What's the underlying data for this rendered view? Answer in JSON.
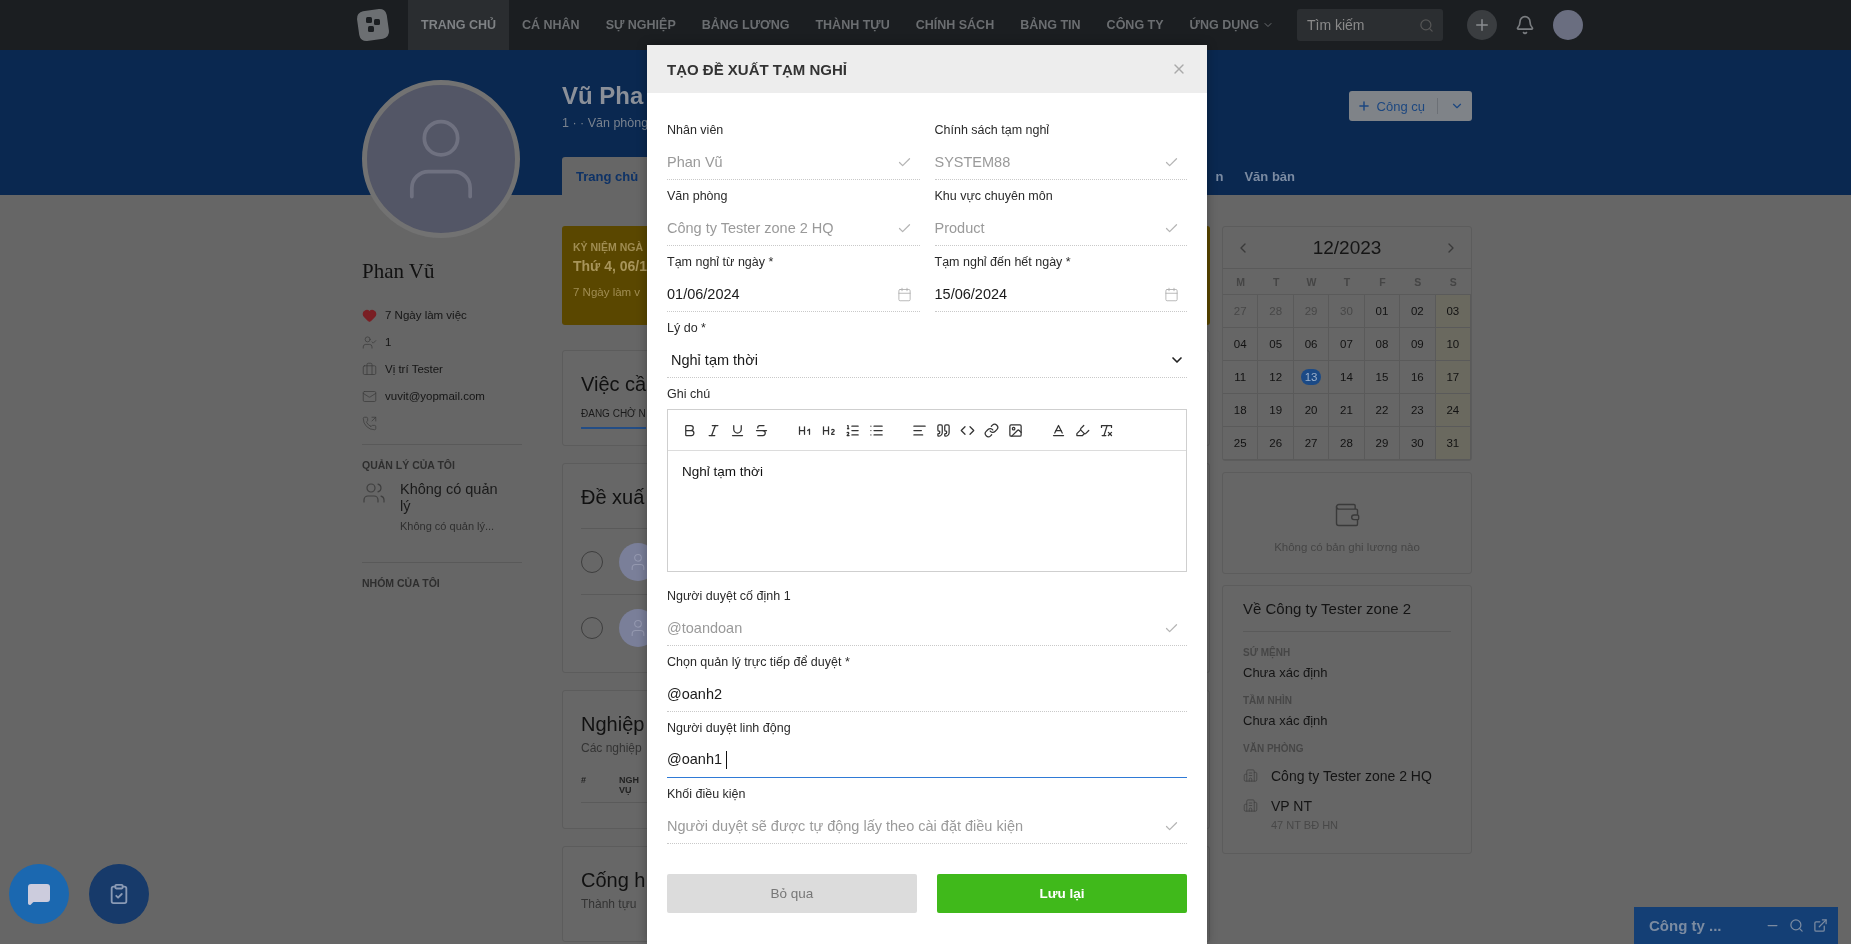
{
  "nav": {
    "items": [
      {
        "label": "TRANG CHỦ",
        "selected": true,
        "dropdown": false
      },
      {
        "label": "CÁ NHÂN",
        "selected": false,
        "dropdown": false
      },
      {
        "label": "SỰ NGHIỆP",
        "selected": false,
        "dropdown": false
      },
      {
        "label": "BẢNG LƯƠNG",
        "selected": false,
        "dropdown": false
      },
      {
        "label": "THÀNH TỰU",
        "selected": false,
        "dropdown": false
      },
      {
        "label": "CHÍNH SÁCH",
        "selected": false,
        "dropdown": false
      },
      {
        "label": "BẢNG TIN",
        "selected": false,
        "dropdown": false
      },
      {
        "label": "CÔNG TY",
        "selected": false,
        "dropdown": false
      },
      {
        "label": "ỨNG DỤNG",
        "selected": false,
        "dropdown": true
      }
    ],
    "search": {
      "placeholder": "Tìm kiếm"
    }
  },
  "header": {
    "name": "Vũ Pha",
    "subtitle": "1 · · Văn phòng",
    "tools_button": "Công cụ",
    "tabs": [
      {
        "label": "Trang chủ",
        "selected": true
      },
      {
        "label": "n",
        "selected": false
      },
      {
        "label": "Văn bản",
        "selected": false
      }
    ]
  },
  "sidebar": {
    "name": "Phan Vũ",
    "details": [
      {
        "kind": "heart",
        "text": "7 Ngày làm việc"
      },
      {
        "kind": "user",
        "text": "1"
      },
      {
        "kind": "briefcase",
        "text": "Vị trí Tester"
      },
      {
        "kind": "mail",
        "text": "vuvit@yopmail.com"
      },
      {
        "kind": "phone"
      }
    ],
    "manager_heading": "QUẢN LÝ CỦA TÔI",
    "manager_name": "Không có quản lý",
    "manager_note": "Không có quản lý...",
    "group_heading": "NHÓM CỦA TÔI"
  },
  "main": {
    "anniversary": {
      "label": "KỶ NIỆM NGÀ",
      "date": "Thứ 4, 06/1",
      "note": "7 Ngày làm v"
    },
    "tasks": {
      "title": "Việc cầ",
      "tab": "ĐANG CHỜ N"
    },
    "proposals": {
      "title": "Đề xuấ",
      "rows": [
        {
          "checked": false
        },
        {
          "checked": false
        }
      ]
    },
    "duties": {
      "title": "Nghiệp",
      "subtitle": "Các nghiệp",
      "columns": [
        "#",
        "NGH VỤ"
      ]
    },
    "achievements": {
      "title": "Cống h",
      "subtitle": "Thành tựu"
    }
  },
  "calendar": {
    "title": "12/2023",
    "weekdays": [
      "M",
      "T",
      "W",
      "T",
      "F",
      "S",
      "S"
    ],
    "days": [
      {
        "label": "27",
        "outside": true,
        "selected": false
      },
      {
        "label": "28",
        "outside": true,
        "selected": false
      },
      {
        "label": "29",
        "outside": true,
        "selected": false
      },
      {
        "label": "30",
        "outside": true,
        "selected": false
      },
      {
        "label": "01",
        "outside": false,
        "selected": false
      },
      {
        "label": "02",
        "outside": false,
        "selected": false
      },
      {
        "label": "03",
        "outside": false,
        "selected": false
      },
      {
        "label": "04",
        "outside": false,
        "selected": false
      },
      {
        "label": "05",
        "outside": false,
        "selected": false
      },
      {
        "label": "06",
        "outside": false,
        "selected": false
      },
      {
        "label": "07",
        "outside": false,
        "selected": false
      },
      {
        "label": "08",
        "outside": false,
        "selected": false
      },
      {
        "label": "09",
        "outside": false,
        "selected": false
      },
      {
        "label": "10",
        "outside": false,
        "selected": false
      },
      {
        "label": "11",
        "outside": false,
        "selected": false
      },
      {
        "label": "12",
        "outside": false,
        "selected": false
      },
      {
        "label": "13",
        "outside": false,
        "selected": true
      },
      {
        "label": "14",
        "outside": false,
        "selected": false
      },
      {
        "label": "15",
        "outside": false,
        "selected": false
      },
      {
        "label": "16",
        "outside": false,
        "selected": false
      },
      {
        "label": "17",
        "outside": false,
        "selected": false
      },
      {
        "label": "18",
        "outside": false,
        "selected": false
      },
      {
        "label": "19",
        "outside": false,
        "selected": false
      },
      {
        "label": "20",
        "outside": false,
        "selected": false
      },
      {
        "label": "21",
        "outside": false,
        "selected": false
      },
      {
        "label": "22",
        "outside": false,
        "selected": false
      },
      {
        "label": "23",
        "outside": false,
        "selected": false
      },
      {
        "label": "24",
        "outside": false,
        "selected": false
      },
      {
        "label": "25",
        "outside": false,
        "selected": false
      },
      {
        "label": "26",
        "outside": false,
        "selected": false
      },
      {
        "label": "27",
        "outside": false,
        "selected": false
      },
      {
        "label": "28",
        "outside": false,
        "selected": false
      },
      {
        "label": "29",
        "outside": false,
        "selected": false
      },
      {
        "label": "30",
        "outside": false,
        "selected": false
      },
      {
        "label": "31",
        "outside": false,
        "selected": false
      }
    ]
  },
  "salary": {
    "text": "Không có bản ghi lương nào"
  },
  "about": {
    "title": "Về Công ty Tester zone 2",
    "mission_label": "SỨ MỆNH",
    "mission": "Chưa xác định",
    "vision_label": "TẦM NHÌN",
    "vision": "Chưa xác định",
    "offices_label": "VĂN PHÒNG",
    "offices": [
      {
        "name": "Công ty Tester zone 2 HQ"
      },
      {
        "name": "VP NT",
        "address": "47 NT BĐ HN"
      }
    ]
  },
  "chat": {
    "title": "Công ty ..."
  },
  "modal": {
    "title": "TẠO ĐỀ XUẤT TẠM NGHỈ",
    "rows": [
      [
        {
          "kind": "locked",
          "label": "Nhân viên",
          "value": "Phan Vũ"
        },
        {
          "kind": "locked",
          "label": "Chính sách tạm nghỉ",
          "value": "SYSTEM88"
        }
      ],
      [
        {
          "kind": "locked",
          "label": "Văn phòng",
          "value": "Công ty Tester zone 2 HQ"
        },
        {
          "kind": "locked",
          "label": "Khu vực chuyên môn",
          "value": "Product"
        }
      ],
      [
        {
          "kind": "date",
          "label": "Tạm nghỉ từ ngày *",
          "value": "01/06/2024"
        },
        {
          "kind": "date",
          "label": "Tạm nghỉ đến hết ngày *",
          "value": "15/06/2024"
        }
      ],
      [
        {
          "kind": "select",
          "label": "Lý do *",
          "value": "Nghỉ tạm thời"
        }
      ],
      [
        {
          "kind": "editor",
          "label": "Ghi chú",
          "value": "Nghỉ tạm thời"
        }
      ],
      [
        {
          "kind": "locked",
          "label": "Người duyệt cố định 1",
          "value": "@toandoan"
        }
      ],
      [
        {
          "kind": "text",
          "label": "Chọn quản lý trực tiếp để duyệt *",
          "value": "@oanh2",
          "focused": false
        }
      ],
      [
        {
          "kind": "text",
          "label": "Người duyệt linh động",
          "value": "@oanh1",
          "focused": true
        }
      ],
      [
        {
          "kind": "locked",
          "label": "Khối điều kiện",
          "value": "Người duyệt sẽ được tự động lấy theo cài đặt điều kiện"
        }
      ]
    ],
    "cancel_button": "Bỏ qua",
    "save_button": "Lưu lại"
  }
}
